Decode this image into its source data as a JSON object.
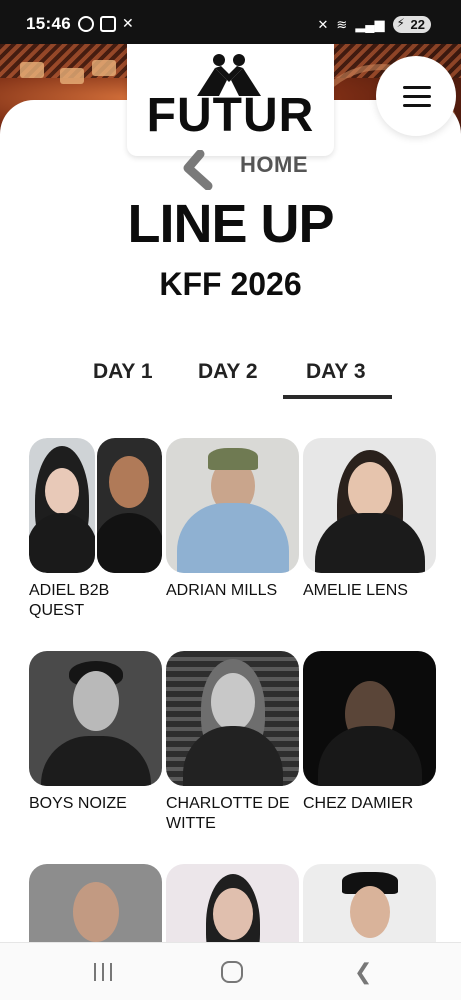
{
  "status_bar": {
    "time": "15:46",
    "battery": "22",
    "icons_left": [
      "whatsapp-icon",
      "screenshot-icon",
      "missed-call-icon"
    ],
    "icons_right": [
      "mute-icon",
      "wifi-icon",
      "signal-icon",
      "battery-icon"
    ]
  },
  "header": {
    "logo_text": "FUTUR",
    "menu_icon": "hamburger-icon"
  },
  "nav": {
    "home_label": "HOME"
  },
  "page": {
    "title": "LINE UP",
    "subtitle": "KFF 2026"
  },
  "tabs": [
    {
      "label": "DAY 1",
      "active": false
    },
    {
      "label": "DAY 2",
      "active": false
    },
    {
      "label": "DAY 3",
      "active": true
    }
  ],
  "artists": [
    {
      "name": "ADIEL B2B QUEST"
    },
    {
      "name": "ADRIAN MILLS"
    },
    {
      "name": "AMELIE LENS"
    },
    {
      "name": "BOYS NOIZE"
    },
    {
      "name": "CHARLOTTE DE WITTE"
    },
    {
      "name": "CHEZ DAMIER"
    },
    {
      "name": ""
    },
    {
      "name": ""
    },
    {
      "name": ""
    }
  ],
  "colors": {
    "accent": "#2a2a2a",
    "text": "#0d0d0d",
    "muted": "#555555"
  },
  "system_nav": [
    "recent-apps-icon",
    "home-icon",
    "back-icon"
  ]
}
